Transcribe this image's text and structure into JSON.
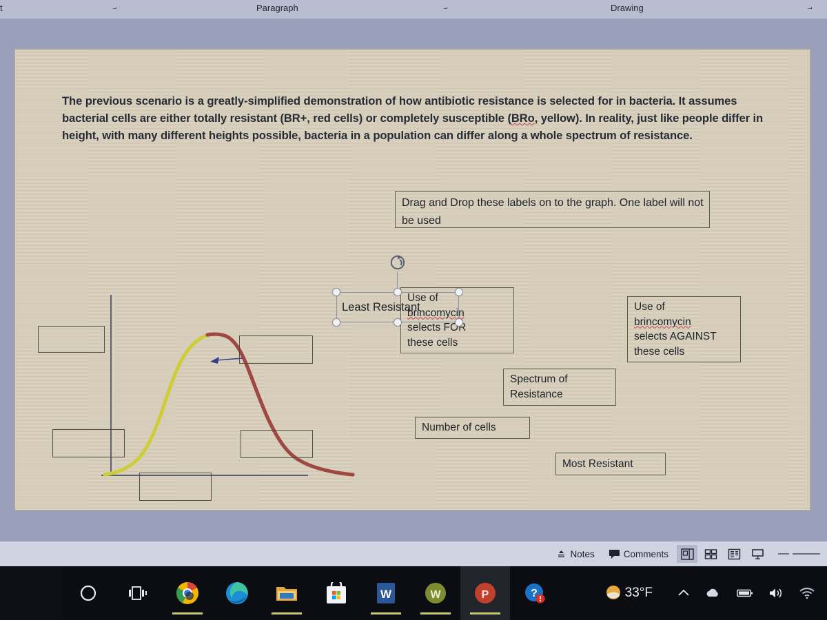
{
  "ribbon": {
    "left_letter": "t",
    "groups": [
      {
        "label": "Paragraph"
      },
      {
        "label": "Drawing"
      }
    ],
    "launcher_icon": "dialog-launcher-icon"
  },
  "slide": {
    "body_text_part1": "The previous scenario is a greatly-simplified demonstration of how antibiotic resistance is selected for in bacteria. It assumes bacterial cells are either totally resistant (BR+, red cells) or completely susceptible (",
    "body_text_misspelled": "BRo",
    "body_text_part2": ", yellow). In reality, just like people differ in height, with many different heights possible, bacteria in a population can differ along a whole spectrum of resistance.",
    "instruction_box": "Drag and Drop these labels on to the graph. One label will not be used",
    "selected_label": "Least Resistant",
    "labels": [
      {
        "name": "selects-for-box",
        "line1": "Use of",
        "line2": "brincomycin",
        "line3": "selects FOR",
        "line4": "these cells"
      },
      {
        "name": "selects-against-box",
        "line1": "Use of",
        "line2": "brincomycin",
        "line3": "selects AGAINST",
        "line4": "these cells"
      }
    ],
    "spectrum_line1": "Spectrum of",
    "spectrum_line2": "Resistance",
    "number_of_cells": "Number of cells",
    "most_resistant": "Most Resistant",
    "drop_box_count": 5,
    "colors": {
      "curve_yellow": "#cfcc3c",
      "curve_red": "#9f4841",
      "arrow_blue": "#333f86",
      "slide_bg": "#d6cdb8",
      "axis": "#5a5f78",
      "shape_border": "#5b5e4e"
    }
  },
  "chart_data": {
    "type": "line",
    "title": "",
    "xlabel": "Spectrum of Resistance",
    "ylabel": "Number of cells",
    "annotations": [
      {
        "text": "Least Resistant",
        "position": "x-axis-left"
      },
      {
        "text": "Most Resistant",
        "position": "x-axis-right"
      },
      {
        "text": "Use of brincomycin selects FOR these cells",
        "position": "right-tail"
      },
      {
        "text": "Use of brincomycin selects AGAINST these cells",
        "position": "left-peak"
      }
    ],
    "series": [
      {
        "name": "susceptible (yellow segment)",
        "color": "#cfcc3c",
        "x": [
          0,
          4,
          9,
          14,
          19,
          25,
          31,
          37,
          43,
          48
        ],
        "y": [
          0,
          2,
          6,
          13,
          24,
          44,
          66,
          83,
          95,
          99
        ]
      },
      {
        "name": "resistant (red segment)",
        "color": "#9f4841",
        "x": [
          48,
          53,
          58,
          63,
          68,
          73,
          78,
          84,
          90,
          96,
          100
        ],
        "y": [
          99,
          100,
          97,
          89,
          74,
          55,
          36,
          22,
          13,
          8,
          6
        ]
      }
    ],
    "grid": false,
    "legend": "none",
    "xlim": [
      0,
      100
    ],
    "ylim": [
      0,
      105
    ]
  },
  "statusbar": {
    "notes_label": "Notes",
    "comments_label": "Comments",
    "views": [
      "normal-view",
      "slide-sorter-view",
      "reading-view",
      "slide-show-view"
    ],
    "active_view": "normal-view"
  },
  "taskbar": {
    "items": [
      {
        "name": "cortana-icon",
        "running": false
      },
      {
        "name": "task-view-icon",
        "running": false
      },
      {
        "name": "chrome-icon",
        "running": true
      },
      {
        "name": "edge-icon",
        "running": false
      },
      {
        "name": "file-explorer-icon",
        "running": true
      },
      {
        "name": "microsoft-store-icon",
        "running": false
      },
      {
        "name": "word-icon",
        "running": true
      },
      {
        "name": "webex-icon",
        "running": true
      },
      {
        "name": "powerpoint-icon",
        "running": true,
        "active": true
      },
      {
        "name": "help-icon",
        "running": false
      }
    ],
    "weather_temp": "33°F",
    "tray": [
      "show-hidden-icons",
      "onedrive-icon",
      "battery-icon",
      "volume-icon",
      "wifi-icon"
    ]
  }
}
